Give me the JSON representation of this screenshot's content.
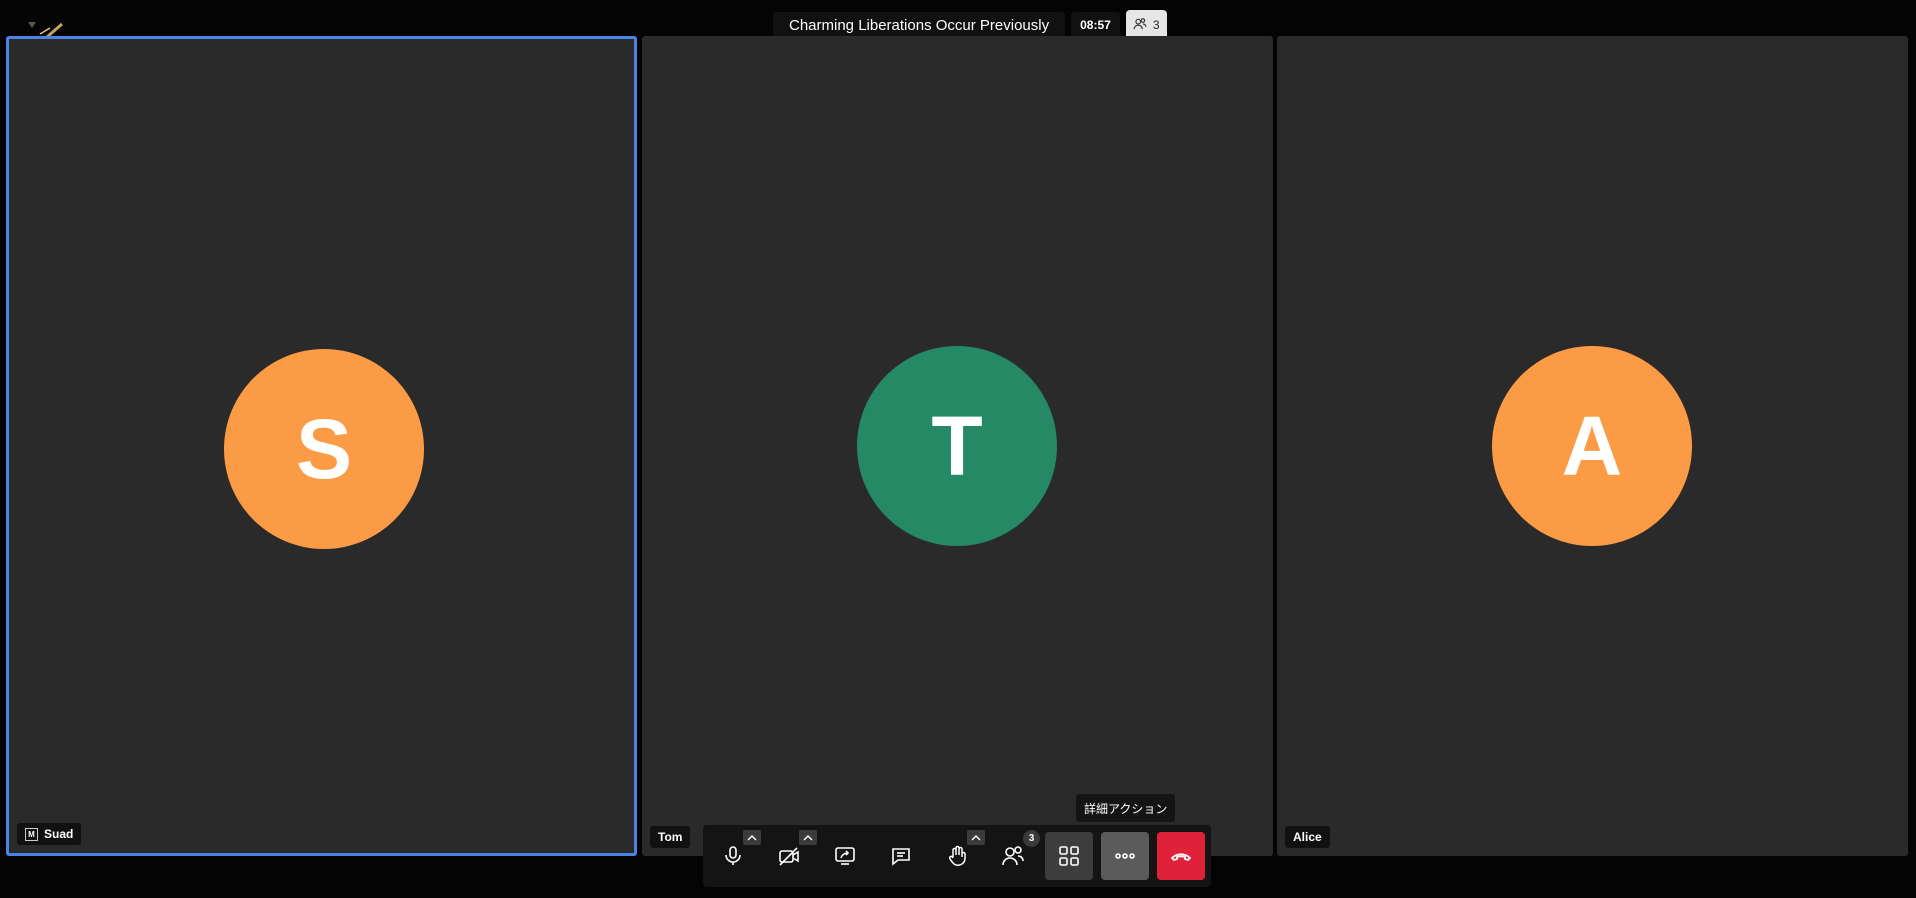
{
  "meeting": {
    "title": "Charming Liberations Occur Previously",
    "timer": "08:57",
    "participant_count": "3"
  },
  "participants": [
    {
      "initial": "S",
      "name": "Suad",
      "color": "#fc9b45",
      "active": true,
      "moderator_badge": "M"
    },
    {
      "initial": "T",
      "name": "Tom",
      "color": "#258966",
      "active": false
    },
    {
      "initial": "A",
      "name": "Alice",
      "color": "#fc9b45",
      "active": false
    }
  ],
  "toolbar": {
    "tooltip": "詳細アクション",
    "participants_badge": "3",
    "buttons": [
      "microphone-icon",
      "camera-off-icon",
      "screen-share-icon",
      "chat-icon",
      "raise-hand-icon",
      "participants-icon",
      "tile-view-icon",
      "more-icon",
      "hangup-icon"
    ]
  }
}
